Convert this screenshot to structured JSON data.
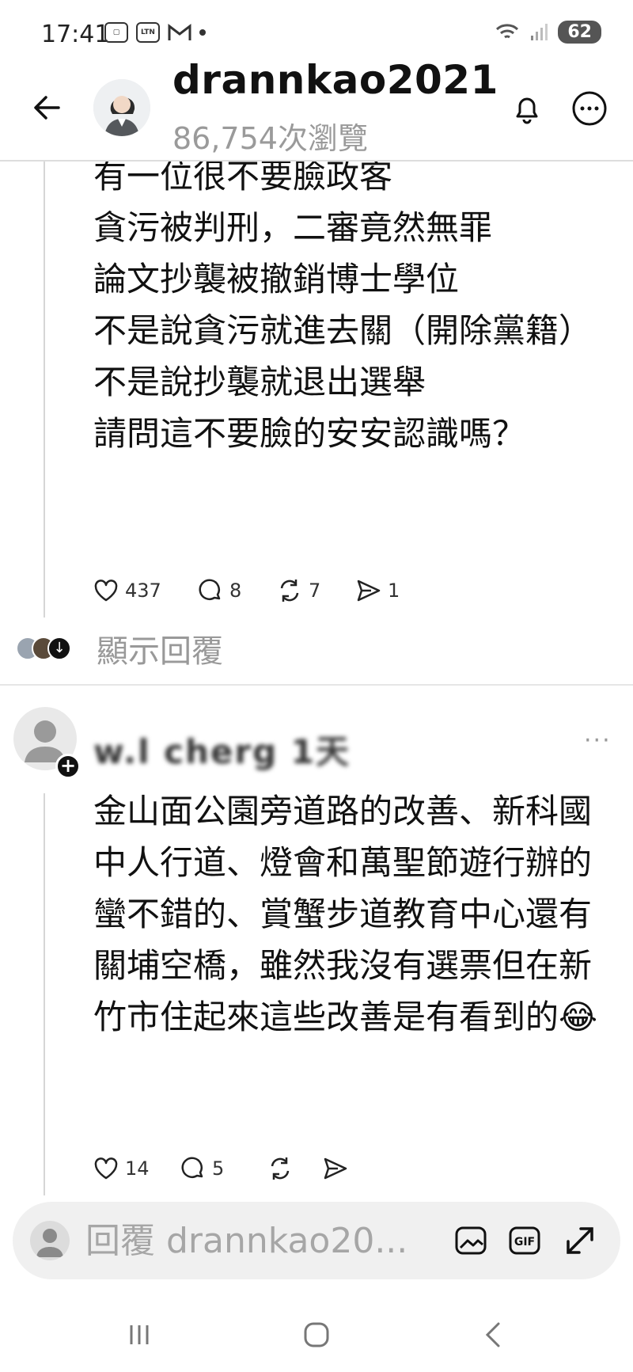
{
  "status_bar": {
    "time": "17:41",
    "notif_icon_1": "screenshot-icon",
    "notif_icon_2_label": "LTN",
    "notif_icon_3": "gmail-icon",
    "battery": "62"
  },
  "header": {
    "username": "drannkao2021",
    "views": "86,754次瀏覽"
  },
  "post": {
    "text": "有一位很不要臉政客\n貪污被判刑，二審竟然無罪\n論文抄襲被撤銷博士學位\n不是說貪污就進去關（開除黨籍）\n不是說抄襲就退出選舉\n請問這不要臉的安安認識嗎？",
    "likes": "437",
    "comments": "8",
    "reposts": "7",
    "shares": "1"
  },
  "show_replies": "顯示回覆",
  "reply": {
    "username": "w.l cherg 1天",
    "text": "金山面公園旁道路的改善、新科國中人行道、燈會和萬聖節遊行辦的蠻不錯的、賞蟹步道教育中心還有關埔空橋，雖然我沒有選票但在新竹市住起來這些改善是有看到的😂",
    "likes": "14",
    "comments": "5",
    "reposts": "",
    "shares": ""
  },
  "composer": {
    "placeholder": "回覆 drannkao20..."
  },
  "colors": {
    "text": "#111111",
    "muted": "#999999",
    "divider": "#e6e6e6",
    "composer_bg": "#f0f0f0"
  }
}
